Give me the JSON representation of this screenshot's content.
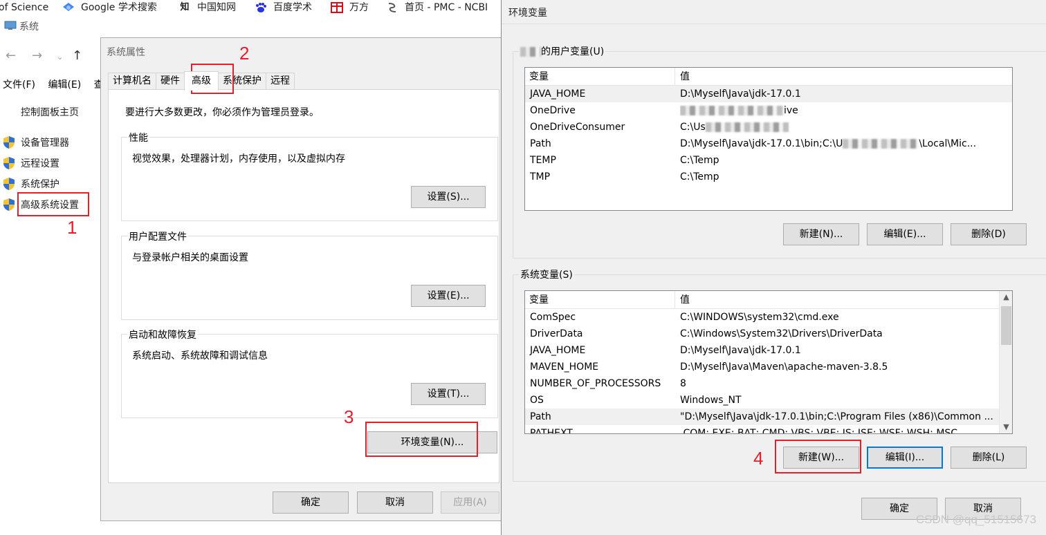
{
  "bookmarks": [
    {
      "label": "of Science",
      "icon": "web-of-science-icon"
    },
    {
      "label": "Google 学术搜索",
      "icon": "google-scholar-icon"
    },
    {
      "label": "中国知网",
      "icon": "cnki-icon"
    },
    {
      "label": "百度学术",
      "icon": "baidu-icon"
    },
    {
      "label": "万方",
      "icon": "wanfang-icon"
    },
    {
      "label": "首页 - PMC - NCBI",
      "icon": "ncbi-icon"
    }
  ],
  "system_window": {
    "title": "系统",
    "menu": [
      "文件(F)",
      "编辑(E)",
      "查"
    ],
    "control_panel_home": "控制面板主页",
    "side_links": [
      "设备管理器",
      "远程设置",
      "系统保护",
      "高级系统设置"
    ]
  },
  "system_properties": {
    "title": "系统属性",
    "tabs": [
      "计算机名",
      "硬件",
      "高级",
      "系统保护",
      "远程"
    ],
    "active_tab": "高级",
    "admin_note": "要进行大多数更改，你必须作为管理员登录。",
    "groups": [
      {
        "title": "性能",
        "desc": "视觉效果，处理器计划，内存使用，以及虚拟内存",
        "button": "设置(S)..."
      },
      {
        "title": "用户配置文件",
        "desc": "与登录帐户相关的桌面设置",
        "button": "设置(E)..."
      },
      {
        "title": "启动和故障恢复",
        "desc": "系统启动、系统故障和调试信息",
        "button": "设置(T)..."
      }
    ],
    "env_button": "环境变量(N)...",
    "ok": "确定",
    "cancel": "取消",
    "apply": "应用(A)"
  },
  "env_dialog": {
    "title": "环境变量",
    "user_group_title": "的用户变量(U)",
    "col_var": "变量",
    "col_val": "值",
    "user_vars": [
      {
        "name": "JAVA_HOME",
        "value": "D:\\Myself\\Java\\jdk-17.0.1"
      },
      {
        "name": "OneDrive",
        "value": "ive"
      },
      {
        "name": "OneDriveConsumer",
        "value": "C:\\Us"
      },
      {
        "name": "Path",
        "value": "D:\\Myself\\Java\\jdk-17.0.1\\bin;C:\\U",
        "value_tail": "\\Local\\Mic..."
      },
      {
        "name": "TEMP",
        "value": "C:\\Temp"
      },
      {
        "name": "TMP",
        "value": "C:\\Temp"
      }
    ],
    "user_buttons": {
      "new": "新建(N)...",
      "edit": "编辑(E)...",
      "delete": "删除(D)"
    },
    "system_group_title": "系统变量(S)",
    "system_vars": [
      {
        "name": "ComSpec",
        "value": "C:\\WINDOWS\\system32\\cmd.exe"
      },
      {
        "name": "DriverData",
        "value": "C:\\Windows\\System32\\Drivers\\DriverData"
      },
      {
        "name": "JAVA_HOME",
        "value": "D:\\Myself\\Java\\jdk-17.0.1"
      },
      {
        "name": "MAVEN_HOME",
        "value": "D:\\Myself\\Java\\Maven\\apache-maven-3.8.5"
      },
      {
        "name": "NUMBER_OF_PROCESSORS",
        "value": "8"
      },
      {
        "name": "OS",
        "value": "Windows_NT"
      },
      {
        "name": "Path",
        "value": "\"D:\\Myself\\Java\\jdk-17.0.1\\bin;C:\\Program Files (x86)\\Common ..."
      },
      {
        "name": "PATHEXT",
        "value": ".COM;.EXE;.BAT;.CMD;.VBS;.VBE;.JS;.JSE;.WSF;.WSH;.MSC"
      }
    ],
    "system_buttons": {
      "new": "新建(W)...",
      "edit": "编辑(I)...",
      "delete": "删除(L)"
    },
    "ok": "确定",
    "cancel": "取消"
  },
  "annotations": [
    "1",
    "2",
    "3",
    "4"
  ],
  "watermark": "CSDN @qq_51515673",
  "colors": {
    "annotation_red": "#e0202c",
    "focus_blue": "#0078d7",
    "dialog_bg": "#f0f0f0"
  }
}
